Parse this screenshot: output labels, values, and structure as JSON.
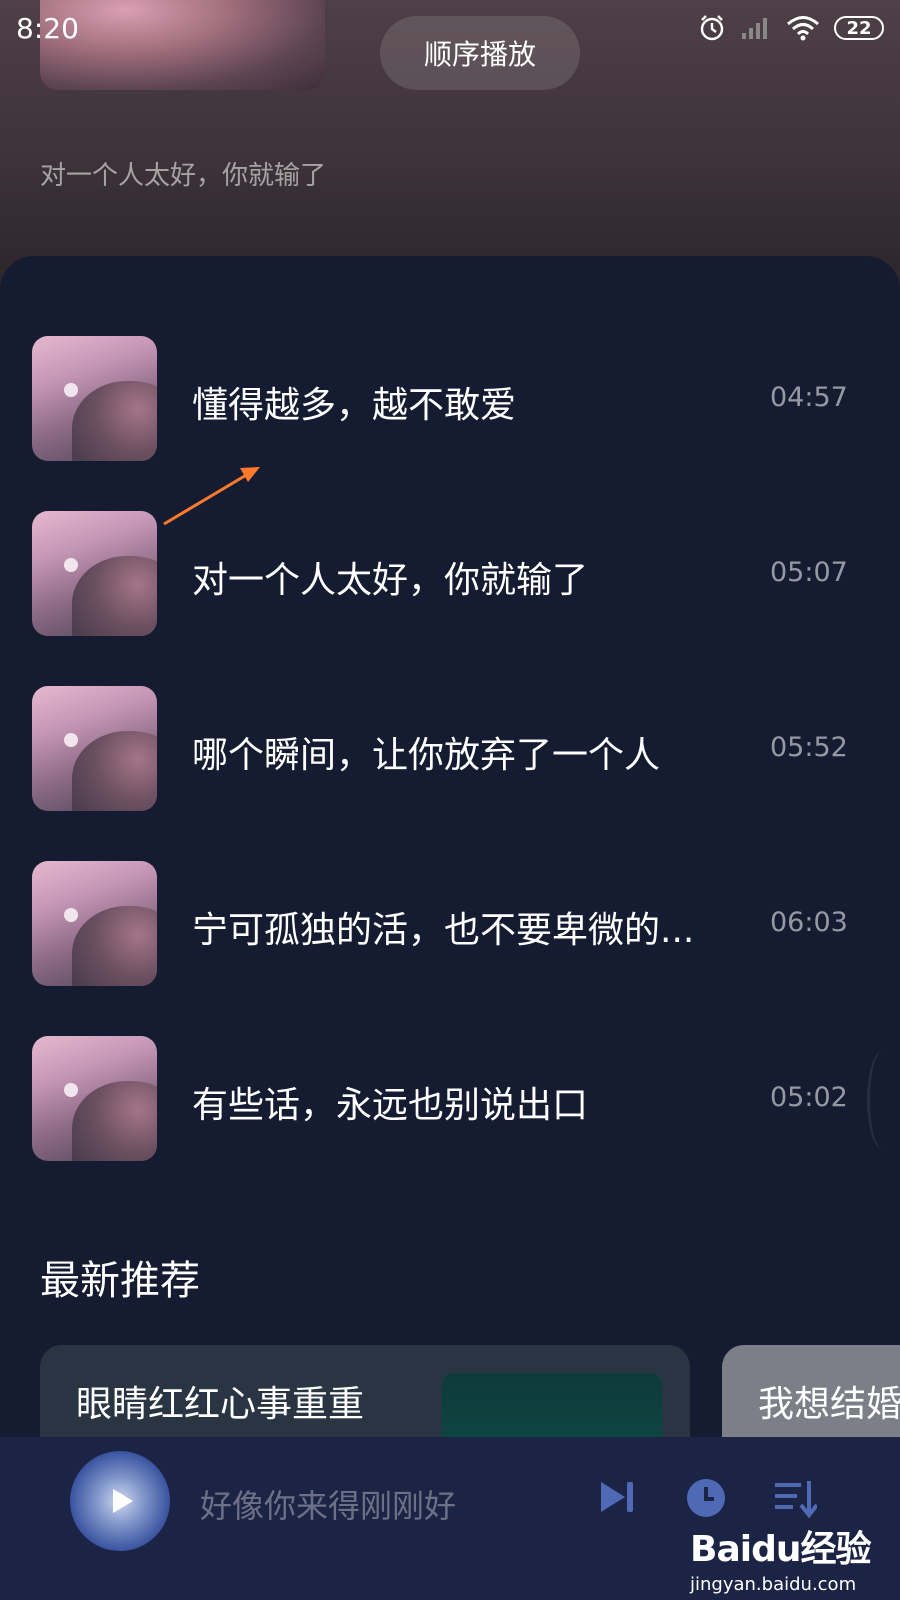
{
  "status": {
    "time": "8:20",
    "battery": "22"
  },
  "header": {
    "play_mode_label": "顺序播放",
    "subtitle": "对一个人太好，你就输了"
  },
  "songs": [
    {
      "title": "懂得越多，越不敢爱",
      "duration": "04:57"
    },
    {
      "title": "对一个人太好，你就输了",
      "duration": "05:07"
    },
    {
      "title": "哪个瞬间，让你放弃了一个人",
      "duration": "05:52"
    },
    {
      "title": "宁可孤独的活，也不要卑微的...",
      "duration": "06:03"
    },
    {
      "title": "有些话，永远也别说出口",
      "duration": "05:02"
    }
  ],
  "recommend": {
    "title": "最新推荐",
    "cards": [
      {
        "title": "眼睛红红心事重重"
      },
      {
        "title": "我想结婚"
      }
    ]
  },
  "player": {
    "now_playing": "好像你来得刚刚好"
  },
  "watermark": {
    "brand": "Baidu经验",
    "domain": "jingyan.baidu.com"
  },
  "colors": {
    "panel_bg": "#151c31",
    "player_bg": "#1c2446",
    "arrow": "#ff7a2a"
  }
}
